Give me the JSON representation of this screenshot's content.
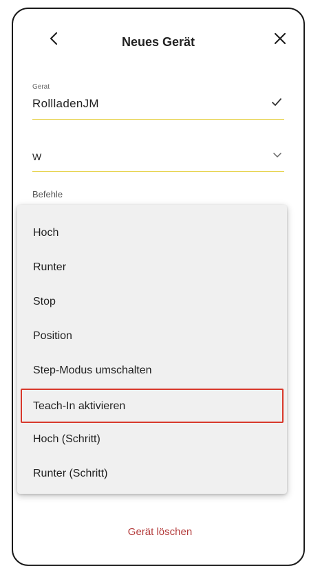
{
  "header": {
    "title": "Neues Gerät",
    "back_icon": "chevron-left-icon",
    "close_icon": "close-icon"
  },
  "device_field": {
    "label": "Gerat",
    "value": "RollladenJM",
    "status_icon": "check-icon"
  },
  "type_field": {
    "value": "W",
    "icon": "chevron-down-icon"
  },
  "commands": {
    "label": "Befehle",
    "options": [
      "Hoch",
      "Runter",
      "Stop",
      "Position",
      "Step-Modus umschalten",
      "Teach-In aktivieren",
      "Hoch (Schritt)",
      "Runter (Schritt)"
    ],
    "highlighted": "Teach-In aktivieren"
  },
  "footer": {
    "delete_label": "Gerät löschen"
  },
  "colors": {
    "accent_underline": "#e6d24a",
    "highlight_border": "#d8382b",
    "delete_text": "#b33a3a"
  }
}
